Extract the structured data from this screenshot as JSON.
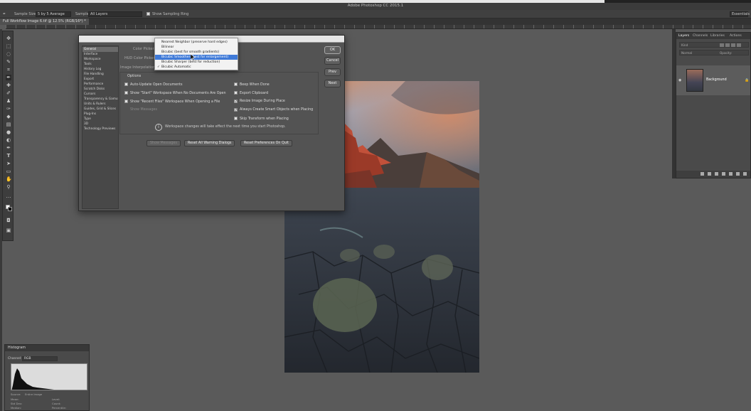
{
  "app": {
    "title": "Adobe Photoshop CC 2015.1"
  },
  "options_bar": {
    "sample_size_label": "Sample Size:",
    "sample_size_value": "5 by 5 Average",
    "sample_label": "Sample:",
    "sample_value": "All Layers",
    "show_sampling_ring": "Show Sampling Ring",
    "right_control": "Essentials"
  },
  "document_tab": "Full Workflow Image 6.tif @ 12.5% (RGB/16*) *",
  "dialog": {
    "categories": [
      "General",
      "Interface",
      "Workspace",
      "Tools",
      "History Log",
      "File Handling",
      "Export",
      "Performance",
      "Scratch Disks",
      "Cursors",
      "Transparency & Gamut",
      "Units & Rulers",
      "Guides, Grid & Slices",
      "Plug-Ins",
      "Type",
      "3D",
      "Technology Previews"
    ],
    "color_picker_label": "Color Picker:",
    "hud_color_picker_label": "HUD Color Picker:",
    "image_interpolation_label": "Image Interpolation:",
    "options_legend": "Options",
    "checkboxes_left": [
      {
        "label": "Auto-Update Open Documents",
        "checked": false,
        "enabled": true
      },
      {
        "label": "Show \"Start\" Workspace When No Documents Are Open",
        "checked": false,
        "enabled": true
      },
      {
        "label": "Show \"Recent Files\" Workspace When Opening a File",
        "checked": false,
        "enabled": true
      },
      {
        "label": "Show Messages",
        "checked": false,
        "enabled": false
      }
    ],
    "checkboxes_right": [
      {
        "label": "Beep When Done",
        "checked": false,
        "enabled": true
      },
      {
        "label": "Export Clipboard",
        "checked": false,
        "enabled": true
      },
      {
        "label": "Resize Image During Place",
        "checked": true,
        "enabled": true
      },
      {
        "label": "Always Create Smart Objects when Placing",
        "checked": true,
        "enabled": true
      },
      {
        "label": "Skip Transform when Placing",
        "checked": false,
        "enabled": true
      }
    ],
    "info_text": "Workspace changes will take effect the next time you start Photoshop.",
    "buttons_bottom": {
      "show_messages": "Show Messages",
      "reset_warnings": "Reset All Warning Dialogs",
      "reset_prefs": "Reset Preferences On Quit"
    },
    "buttons_side": {
      "ok": "OK",
      "cancel": "Cancel",
      "prev": "Prev",
      "next": "Next"
    }
  },
  "interpolation_menu": {
    "items": [
      {
        "label": "Nearest Neighbor (preserve hard edges)",
        "highlighted": false,
        "checked": false
      },
      {
        "label": "Bilinear",
        "highlighted": false,
        "checked": false
      },
      {
        "label": "Bicubic (best for smooth gradients)",
        "highlighted": false,
        "checked": false
      },
      {
        "label": "Bicubic Smoother (best for enlargement)",
        "highlighted": true,
        "checked": false
      },
      {
        "label": "Bicubic Sharper (best for reduction)",
        "highlighted": false,
        "checked": false
      },
      {
        "label": "Bicubic Automatic",
        "highlighted": false,
        "checked": true
      }
    ],
    "check_glyph": "✓"
  },
  "layers_panel": {
    "tabs": [
      "Layers",
      "Channels",
      "Libraries",
      "Actions"
    ],
    "active_tab": "Layers",
    "filter_label": "Kind",
    "mode_label": "Normal",
    "opacity_label": "Opacity:",
    "layer_name": "Background"
  },
  "histogram_panel": {
    "title": "Histogram",
    "channel_label": "Channel:",
    "channel_value": "RGB",
    "source_label": "Source:",
    "source_value": "Entire Image",
    "stats_left": [
      "Mean:",
      "Std Dev:",
      "Median:"
    ],
    "stats_right": [
      "Level:",
      "Count:",
      "Percentile:"
    ],
    "warning_glyph": "⚠"
  },
  "colors": {
    "accent_highlight": "#3f7ad8",
    "panel_bg": "#4a4a4a",
    "canvas_bg": "#5a5a5a"
  }
}
